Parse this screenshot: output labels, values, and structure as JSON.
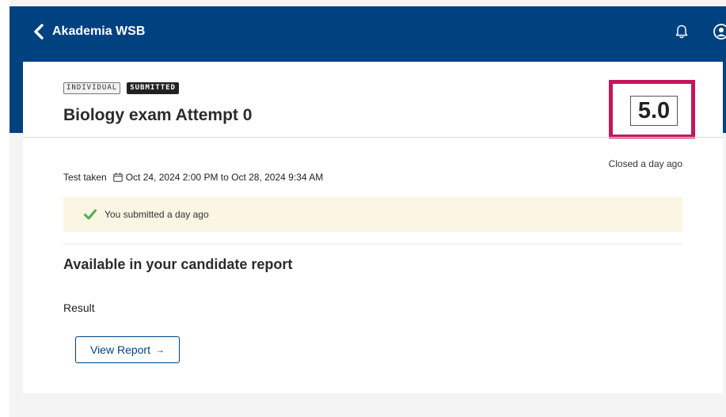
{
  "header": {
    "back_label": "Akademia WSB",
    "icons": [
      "chevron-left-icon",
      "bell-icon",
      "user-circle-icon"
    ],
    "bar_color": "#00417f"
  },
  "assessment": {
    "badges": {
      "type": "INDIVIDUAL",
      "status": "SUBMITTED"
    },
    "title": "Biology exam Attempt 0",
    "score": "5.0",
    "closed_text": "Closed a day ago",
    "test_taken_label": "Test taken",
    "test_taken_range": "Oct 24, 2024 2:00 PM to Oct 28, 2024 9:34 AM",
    "notice": "You submitted a day ago"
  },
  "report": {
    "heading": "Available in your candidate report",
    "result_label": "Result",
    "view_button_label": "View Report",
    "view_button_arrow": "→"
  },
  "colors": {
    "accent": "#00417f",
    "highlight": "#c2185b",
    "success": "#4caf50",
    "notice_bg": "#fbf5e3"
  }
}
